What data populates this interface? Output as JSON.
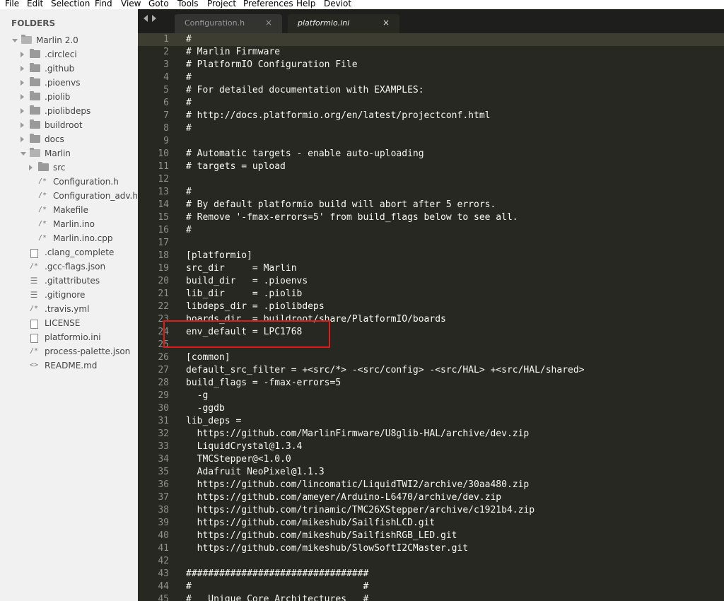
{
  "menu": [
    "File",
    "Edit",
    "Selection",
    "Find",
    "View",
    "Goto",
    "Tools",
    "Project",
    "Preferences",
    "Help",
    "Deviot"
  ],
  "sidebar": {
    "header": "FOLDERS",
    "tree": [
      {
        "label": "Marlin 2.0",
        "icon": "folder-open-icon"
      },
      {
        "label": ".circleci",
        "icon": "folder-icon"
      },
      {
        "label": ".github",
        "icon": "folder-icon"
      },
      {
        "label": ".pioenvs",
        "icon": "folder-icon"
      },
      {
        "label": ".piolib",
        "icon": "folder-icon"
      },
      {
        "label": ".piolibdeps",
        "icon": "folder-icon"
      },
      {
        "label": "buildroot",
        "icon": "folder-icon"
      },
      {
        "label": "docs",
        "icon": "folder-icon"
      },
      {
        "label": "Marlin",
        "icon": "folder-open-icon"
      },
      {
        "label": "src",
        "icon": "folder-icon"
      },
      {
        "label": "Configuration.h",
        "icon": "c-comment-file-icon",
        "glyph": "/*"
      },
      {
        "label": "Configuration_adv.h",
        "icon": "c-comment-file-icon",
        "glyph": "/*"
      },
      {
        "label": "Makefile",
        "icon": "c-comment-file-icon",
        "glyph": "/*"
      },
      {
        "label": "Marlin.ino",
        "icon": "c-comment-file-icon",
        "glyph": "/*"
      },
      {
        "label": "Marlin.ino.cpp",
        "icon": "c-comment-file-icon",
        "glyph": "/*"
      },
      {
        "label": ".clang_complete",
        "icon": "document-file-icon"
      },
      {
        "label": ".gcc-flags.json",
        "icon": "c-comment-file-icon",
        "glyph": "/*"
      },
      {
        "label": ".gitattributes",
        "icon": "lines-file-icon",
        "glyph": "☰"
      },
      {
        "label": ".gitignore",
        "icon": "lines-file-icon",
        "glyph": "☰"
      },
      {
        "label": ".travis.yml",
        "icon": "c-comment-file-icon",
        "glyph": "/*"
      },
      {
        "label": "LICENSE",
        "icon": "document-file-icon"
      },
      {
        "label": "platformio.ini",
        "icon": "document-file-icon"
      },
      {
        "label": "process-palette.json",
        "icon": "c-comment-file-icon",
        "glyph": "/*"
      },
      {
        "label": "README.md",
        "icon": "markup-file-icon",
        "glyph": "<>"
      }
    ]
  },
  "tabs": [
    {
      "label": "Configuration.h",
      "close": "×"
    },
    {
      "label": "platformio.ini",
      "close": "×"
    }
  ],
  "editor": {
    "lines": [
      "#",
      "# Marlin Firmware",
      "# PlatformIO Configuration File",
      "#",
      "# For detailed documentation with EXAMPLES:",
      "#",
      "# http://docs.platformio.org/en/latest/projectconf.html",
      "#",
      "",
      "# Automatic targets - enable auto-uploading",
      "# targets = upload",
      "",
      "#",
      "# By default platformio build will abort after 5 errors.",
      "# Remove '-fmax-errors=5' from build_flags below to see all.",
      "#",
      "",
      "[platformio]",
      "src_dir     = Marlin",
      "build_dir   = .pioenvs",
      "lib_dir     = .piolib",
      "libdeps_dir = .piolibdeps",
      "boards_dir  = buildroot/share/PlatformIO/boards",
      "env_default = LPC1768",
      "",
      "[common]",
      "default_src_filter = +<src/*> -<src/config> -<src/HAL> +<src/HAL/shared>",
      "build_flags = -fmax-errors=5",
      "  -g",
      "  -ggdb",
      "lib_deps =",
      "  https://github.com/MarlinFirmware/U8glib-HAL/archive/dev.zip",
      "  LiquidCrystal@1.3.4",
      "  TMCStepper@<1.0.0",
      "  Adafruit NeoPixel@1.1.3",
      "  https://github.com/lincomatic/LiquidTWI2/archive/30aa480.zip",
      "  https://github.com/ameyer/Arduino-L6470/archive/dev.zip",
      "  https://github.com/trinamic/TMC26XStepper/archive/c1921b4.zip",
      "  https://github.com/mikeshub/SailfishLCD.git",
      "  https://github.com/mikeshub/SailfishRGB_LED.git",
      "  https://github.com/mikeshub/SlowSoftI2CMaster.git",
      "",
      "#################################",
      "#                               #",
      "#   Unique Core Architectures   #"
    ]
  },
  "colors": {
    "editor_bg": "#272822",
    "text": "#f8f8f2",
    "gutter_text": "#90908a",
    "sidebar_bg": "#f1f1f1",
    "annotation": "#e01b1b"
  }
}
